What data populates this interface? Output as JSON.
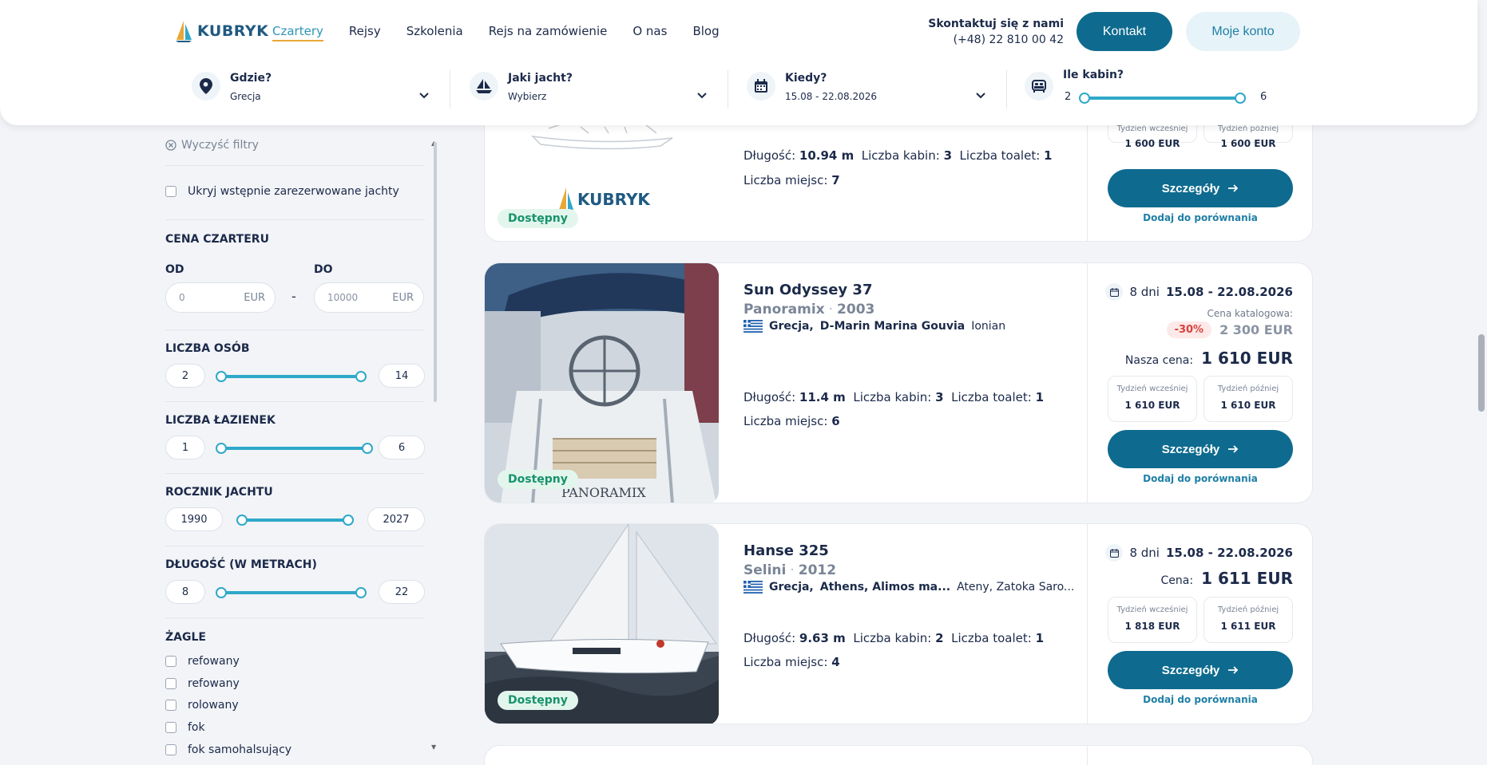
{
  "header": {
    "logo_text": "KUBRYK",
    "nav": [
      "Czartery",
      "Rejsy",
      "Szkolenia",
      "Rejs na zamówienie",
      "O nas",
      "Blog"
    ],
    "contact_title": "Skontaktuj się z nami",
    "contact_phone": "(+48) 22 810 00 42",
    "kontakt_label": "Kontakt",
    "konto_label": "Moje konto"
  },
  "search": {
    "where_label": "Gdzie?",
    "where_value": "Grecja",
    "yacht_label": "Jaki jacht?",
    "yacht_value": "Wybierz",
    "when_label": "Kiedy?",
    "when_value": "15.08 - 22.08.2026",
    "cabins_label": "Ile kabin?",
    "cabins_min": "2",
    "cabins_max": "6"
  },
  "filters": {
    "clear_label": "Wyczyść filtry",
    "hide_reserved": "Ukryj wstępnie zarezerwowane jachty",
    "price_title": "CENA CZARTERU",
    "from_label": "OD",
    "to_label": "DO",
    "from_value": "0",
    "to_value": "10000",
    "currency": "EUR",
    "dash": "-",
    "persons_title": "LICZBA OSÓB",
    "persons_min": "2",
    "persons_max": "14",
    "bathrooms_title": "LICZBA ŁAZIENEK",
    "bathrooms_min": "1",
    "bathrooms_max": "6",
    "year_title": "ROCZNIK JACHTU",
    "year_min": "1990",
    "year_max": "2027",
    "length_title": "DŁUGOŚĆ (W METRACH)",
    "length_min": "8",
    "length_max": "22",
    "sails_title": "ŻAGLE",
    "sails": [
      "refowany",
      "refowany",
      "rolowany",
      "fok",
      "fok samohalsujący"
    ]
  },
  "labels": {
    "available": "Dostępny",
    "length": "Długość:",
    "cabins": "Liczba kabin:",
    "toilets": "Liczba toalet:",
    "places": "Liczba miejsc:",
    "days": "8 dni",
    "dates": "15.08 - 22.08.2026",
    "catalog_price": "Cena katalogowa:",
    "our_price": "Nasza cena:",
    "price": "Cena:",
    "week_before": "Tydzień wcześniej",
    "week_after": "Tydzień później",
    "details": "Szczegóły",
    "compare": "Dodaj do porównania"
  },
  "yachts": [
    {
      "length": "10.94 m",
      "cabins": "3",
      "toilets": "1",
      "places": "7",
      "week_before_price": "1 600 EUR",
      "week_after_price": "1 600 EUR",
      "watermark": "KUBRYK"
    },
    {
      "name": "Sun Odyssey 37",
      "model": "Panoramix",
      "year": "2003",
      "country": "Grecja,",
      "marina": "D-Marin Marina Gouvia",
      "region": "Ionian",
      "discount": "-30%",
      "old_price": "2 300 EUR",
      "price": "1 610 EUR",
      "length": "11.4 m",
      "cabins": "3",
      "toilets": "1",
      "places": "6",
      "week_before_price": "1 610 EUR",
      "week_after_price": "1 610 EUR",
      "hull_text": "PANORAMIX"
    },
    {
      "name": "Hanse 325",
      "model": "Selini",
      "year": "2012",
      "country": "Grecja,",
      "marina": "Athens, Alimos ma...",
      "region": "Ateny, Zatoka Saro...",
      "price": "1 611 EUR",
      "length": "9.63 m",
      "cabins": "2",
      "toilets": "1",
      "places": "4",
      "week_before_price": "1 818 EUR",
      "week_after_price": "1 611 EUR"
    }
  ],
  "colors": {
    "primary": "#0e6b8f",
    "accent": "#2fa8c9",
    "navy": "#1c2a4a",
    "success": "#17936b"
  }
}
